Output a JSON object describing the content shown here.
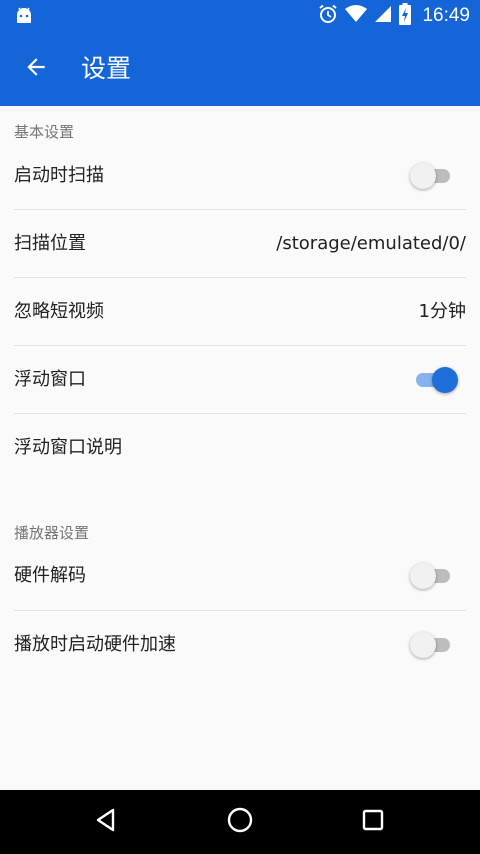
{
  "status_bar": {
    "time": "16:49",
    "icons": [
      "android-notification-icon",
      "alarm-icon",
      "wifi-icon",
      "signal-icon",
      "battery-charging-icon"
    ]
  },
  "app_bar": {
    "title": "设置",
    "back_icon": "arrow-back-icon"
  },
  "sections": [
    {
      "header": "基本设置",
      "items": [
        {
          "label": "启动时扫描",
          "type": "switch",
          "checked": false
        },
        {
          "label": "扫描位置",
          "type": "value",
          "value": "/storage/emulated/0/"
        },
        {
          "label": "忽略短视频",
          "type": "value",
          "value": "1分钟"
        },
        {
          "label": "浮动窗口",
          "type": "switch",
          "checked": true
        },
        {
          "label": "浮动窗口说明",
          "type": "text"
        }
      ]
    },
    {
      "header": "播放器设置",
      "items": [
        {
          "label": "硬件解码",
          "type": "switch",
          "checked": false
        },
        {
          "label": "播放时启动硬件加速",
          "type": "switch",
          "checked": false
        }
      ]
    }
  ],
  "nav_bar": {
    "buttons": [
      "back-triangle-icon",
      "home-circle-icon",
      "recents-square-icon"
    ]
  },
  "colors": {
    "primary": "#1466d8",
    "switch_on": "#1e6fd8"
  }
}
